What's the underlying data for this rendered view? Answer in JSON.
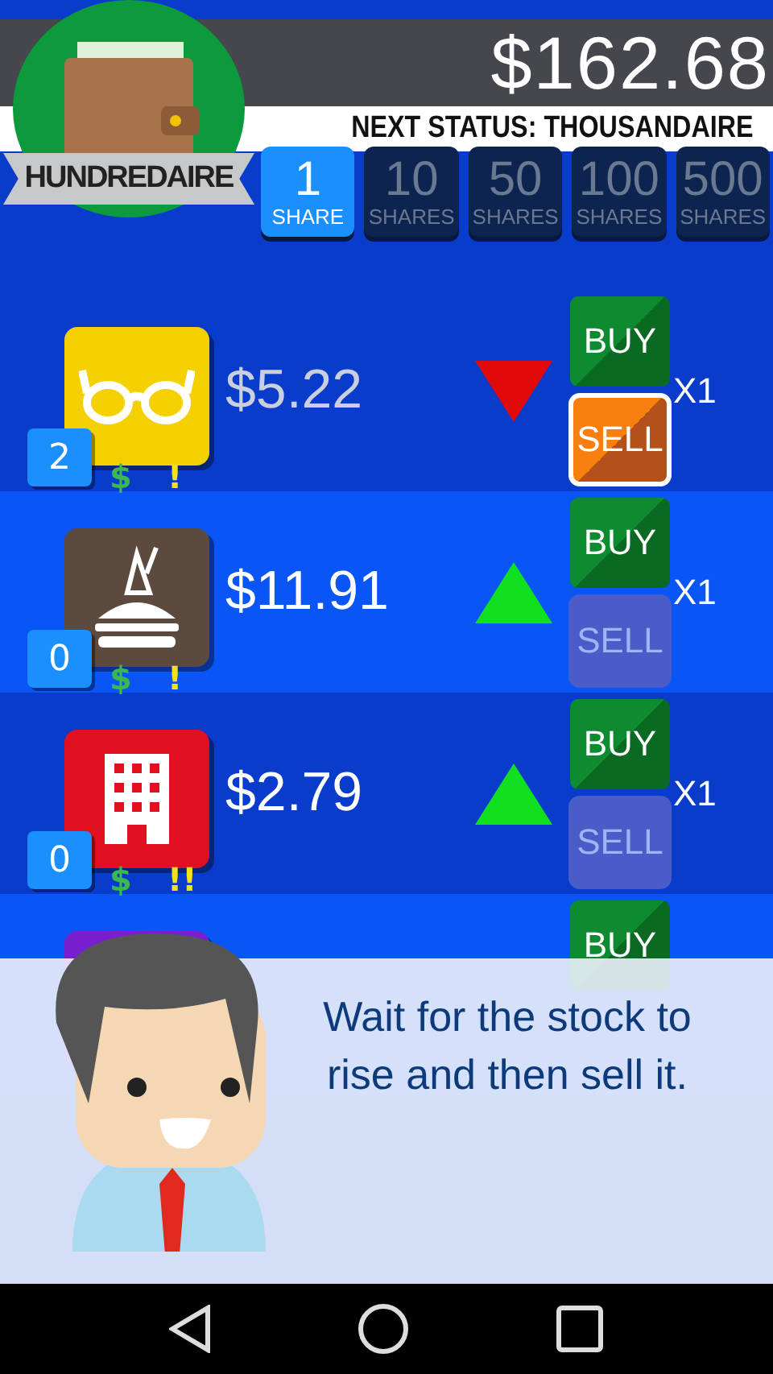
{
  "header": {
    "balance": "$162.68",
    "status_rank": "HUNDREDAIRE",
    "next_status": "NEXT STATUS: THOUSANDAIRE"
  },
  "share_options": [
    {
      "amount": "1",
      "unit": "SHARE",
      "selected": true
    },
    {
      "amount": "10",
      "unit": "SHARES",
      "selected": false
    },
    {
      "amount": "50",
      "unit": "SHARES",
      "selected": false
    },
    {
      "amount": "100",
      "unit": "SHARES",
      "selected": false
    },
    {
      "amount": "500",
      "unit": "SHARES",
      "selected": false
    }
  ],
  "stocks": [
    {
      "kind": "glasses",
      "color": "#f5d000",
      "owned": "2",
      "money_mark": "$",
      "alert": "!",
      "price": "$5.22",
      "rising": false,
      "buy": "BUY",
      "sell": "SELL",
      "sell_enabled": true,
      "multiplier": "X1"
    },
    {
      "kind": "food",
      "color": "#5d4a3e",
      "owned": "0",
      "money_mark": "$",
      "alert": "!",
      "price": "$11.91",
      "rising": true,
      "buy": "BUY",
      "sell": "SELL",
      "sell_enabled": false,
      "multiplier": "X1"
    },
    {
      "kind": "building",
      "color": "#e01020",
      "owned": "0",
      "money_mark": "$",
      "alert": "!!",
      "price": "$2.79",
      "rising": true,
      "buy": "BUY",
      "sell": "SELL",
      "sell_enabled": false,
      "multiplier": "X1"
    },
    {
      "kind": "other",
      "color": "#7a1fd0",
      "buy": "BUY"
    }
  ],
  "tip": {
    "message": "Wait for the stock to rise and then sell it."
  }
}
